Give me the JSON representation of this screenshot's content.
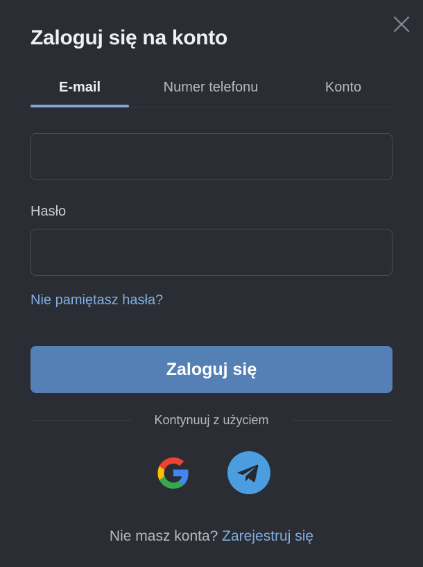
{
  "dialog": {
    "title": "Zaloguj się na konto",
    "close_icon": "close-icon"
  },
  "tabs": [
    {
      "label": "E-mail",
      "active": true
    },
    {
      "label": "Numer telefonu",
      "active": false
    },
    {
      "label": "Konto",
      "active": false
    }
  ],
  "form": {
    "email_value": "",
    "password_label": "Hasło",
    "password_value": "",
    "forgot_link": "Nie pamiętasz hasła?",
    "submit_label": "Zaloguj się"
  },
  "social": {
    "divider_text": "Kontynuuj z użyciem",
    "providers": [
      {
        "name": "google",
        "icon": "google-icon"
      },
      {
        "name": "telegram",
        "icon": "telegram-icon"
      }
    ]
  },
  "footer": {
    "prompt": "Nie masz konta?",
    "signup_link": "Zarejestruj się"
  },
  "colors": {
    "background": "#2a2d33",
    "accent": "#5580b5",
    "link": "#82aee4",
    "tab_indicator": "#7ea7da",
    "telegram": "#4c9de0"
  }
}
